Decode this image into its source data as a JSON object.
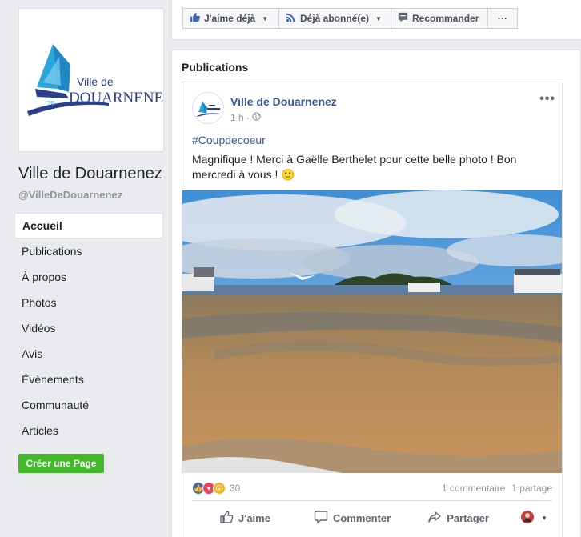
{
  "page": {
    "name": "Ville de Douarnenez",
    "handle": "@VilleDeDouarnenez",
    "logo_text_small": "Ville de",
    "logo_text_big": "DOUARNENEZ"
  },
  "nav": {
    "items": [
      "Accueil",
      "Publications",
      "À propos",
      "Photos",
      "Vidéos",
      "Avis",
      "Évènements",
      "Communauté",
      "Articles"
    ],
    "active": "Accueil"
  },
  "create_page_label": "Créer une Page",
  "toolbar": {
    "like_label": "J'aime déjà",
    "follow_label": "Déjà abonné(e)",
    "recommend_label": "Recommander",
    "more_label": "···"
  },
  "publications": {
    "title": "Publications",
    "post": {
      "author": "Ville de Douarnenez",
      "time": "1 h ·",
      "hashtag": "#Coupdecoeur",
      "text": "Magnifique ! Merci à Gaëlle Berthelet pour cette belle photo ! Bon mercredi à vous ! 🙂",
      "reactions_count": "30",
      "comments": "1 commentaire",
      "shares": "1 partage",
      "actions": {
        "like": "J'aime",
        "comment": "Commenter",
        "share": "Partager"
      }
    }
  },
  "colors": {
    "brand_blue": "#365899",
    "fb_blue": "#4267b2",
    "green": "#42b72a",
    "background": "#e9ebee"
  }
}
